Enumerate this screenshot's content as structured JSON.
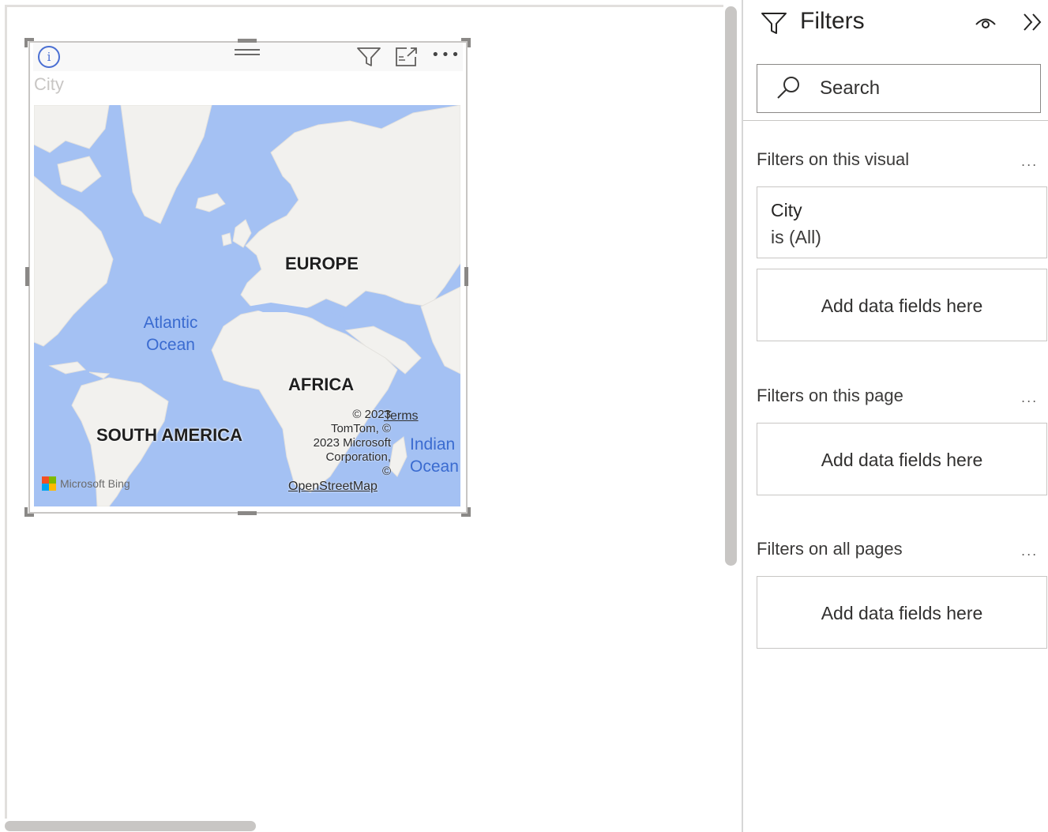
{
  "visual": {
    "title": "City",
    "map": {
      "labels": {
        "europe": "EUROPE",
        "africa": "AFRICA",
        "south_america": "SOUTH AMERICA",
        "atlantic_line1": "Atlantic",
        "atlantic_line2": "Ocean",
        "indian_line1": "Indian",
        "indian_line2": "Ocean"
      },
      "copyright_lines": [
        "© 2023",
        "TomTom, ©",
        "2023 Microsoft",
        "Corporation,",
        "©"
      ],
      "terms_link": "Terms",
      "osm_link": "OpenStreetMap",
      "attribution": "Microsoft Bing",
      "colors": {
        "water": "#a4c1f3",
        "land": "#f2f1ee"
      }
    },
    "header_icons": [
      "info-icon",
      "drag-handle-icon",
      "filter-icon",
      "focus-mode-icon",
      "more-options-icon"
    ]
  },
  "filters_pane": {
    "title": "Filters",
    "search_placeholder": "Search",
    "sections": {
      "visual": {
        "title": "Filters on this visual",
        "more": "...",
        "add_label": "Add data fields here"
      },
      "page": {
        "title": "Filters on this page",
        "more": "...",
        "add_label": "Add data fields here"
      },
      "all_pages": {
        "title": "Filters on all pages",
        "more": "...",
        "add_label": "Add data fields here"
      }
    },
    "city_filter": {
      "field": "City",
      "value": "is (All)"
    },
    "icons": [
      "filter-icon",
      "eye-icon",
      "collapse-chevrons-icon",
      "search-icon"
    ]
  }
}
